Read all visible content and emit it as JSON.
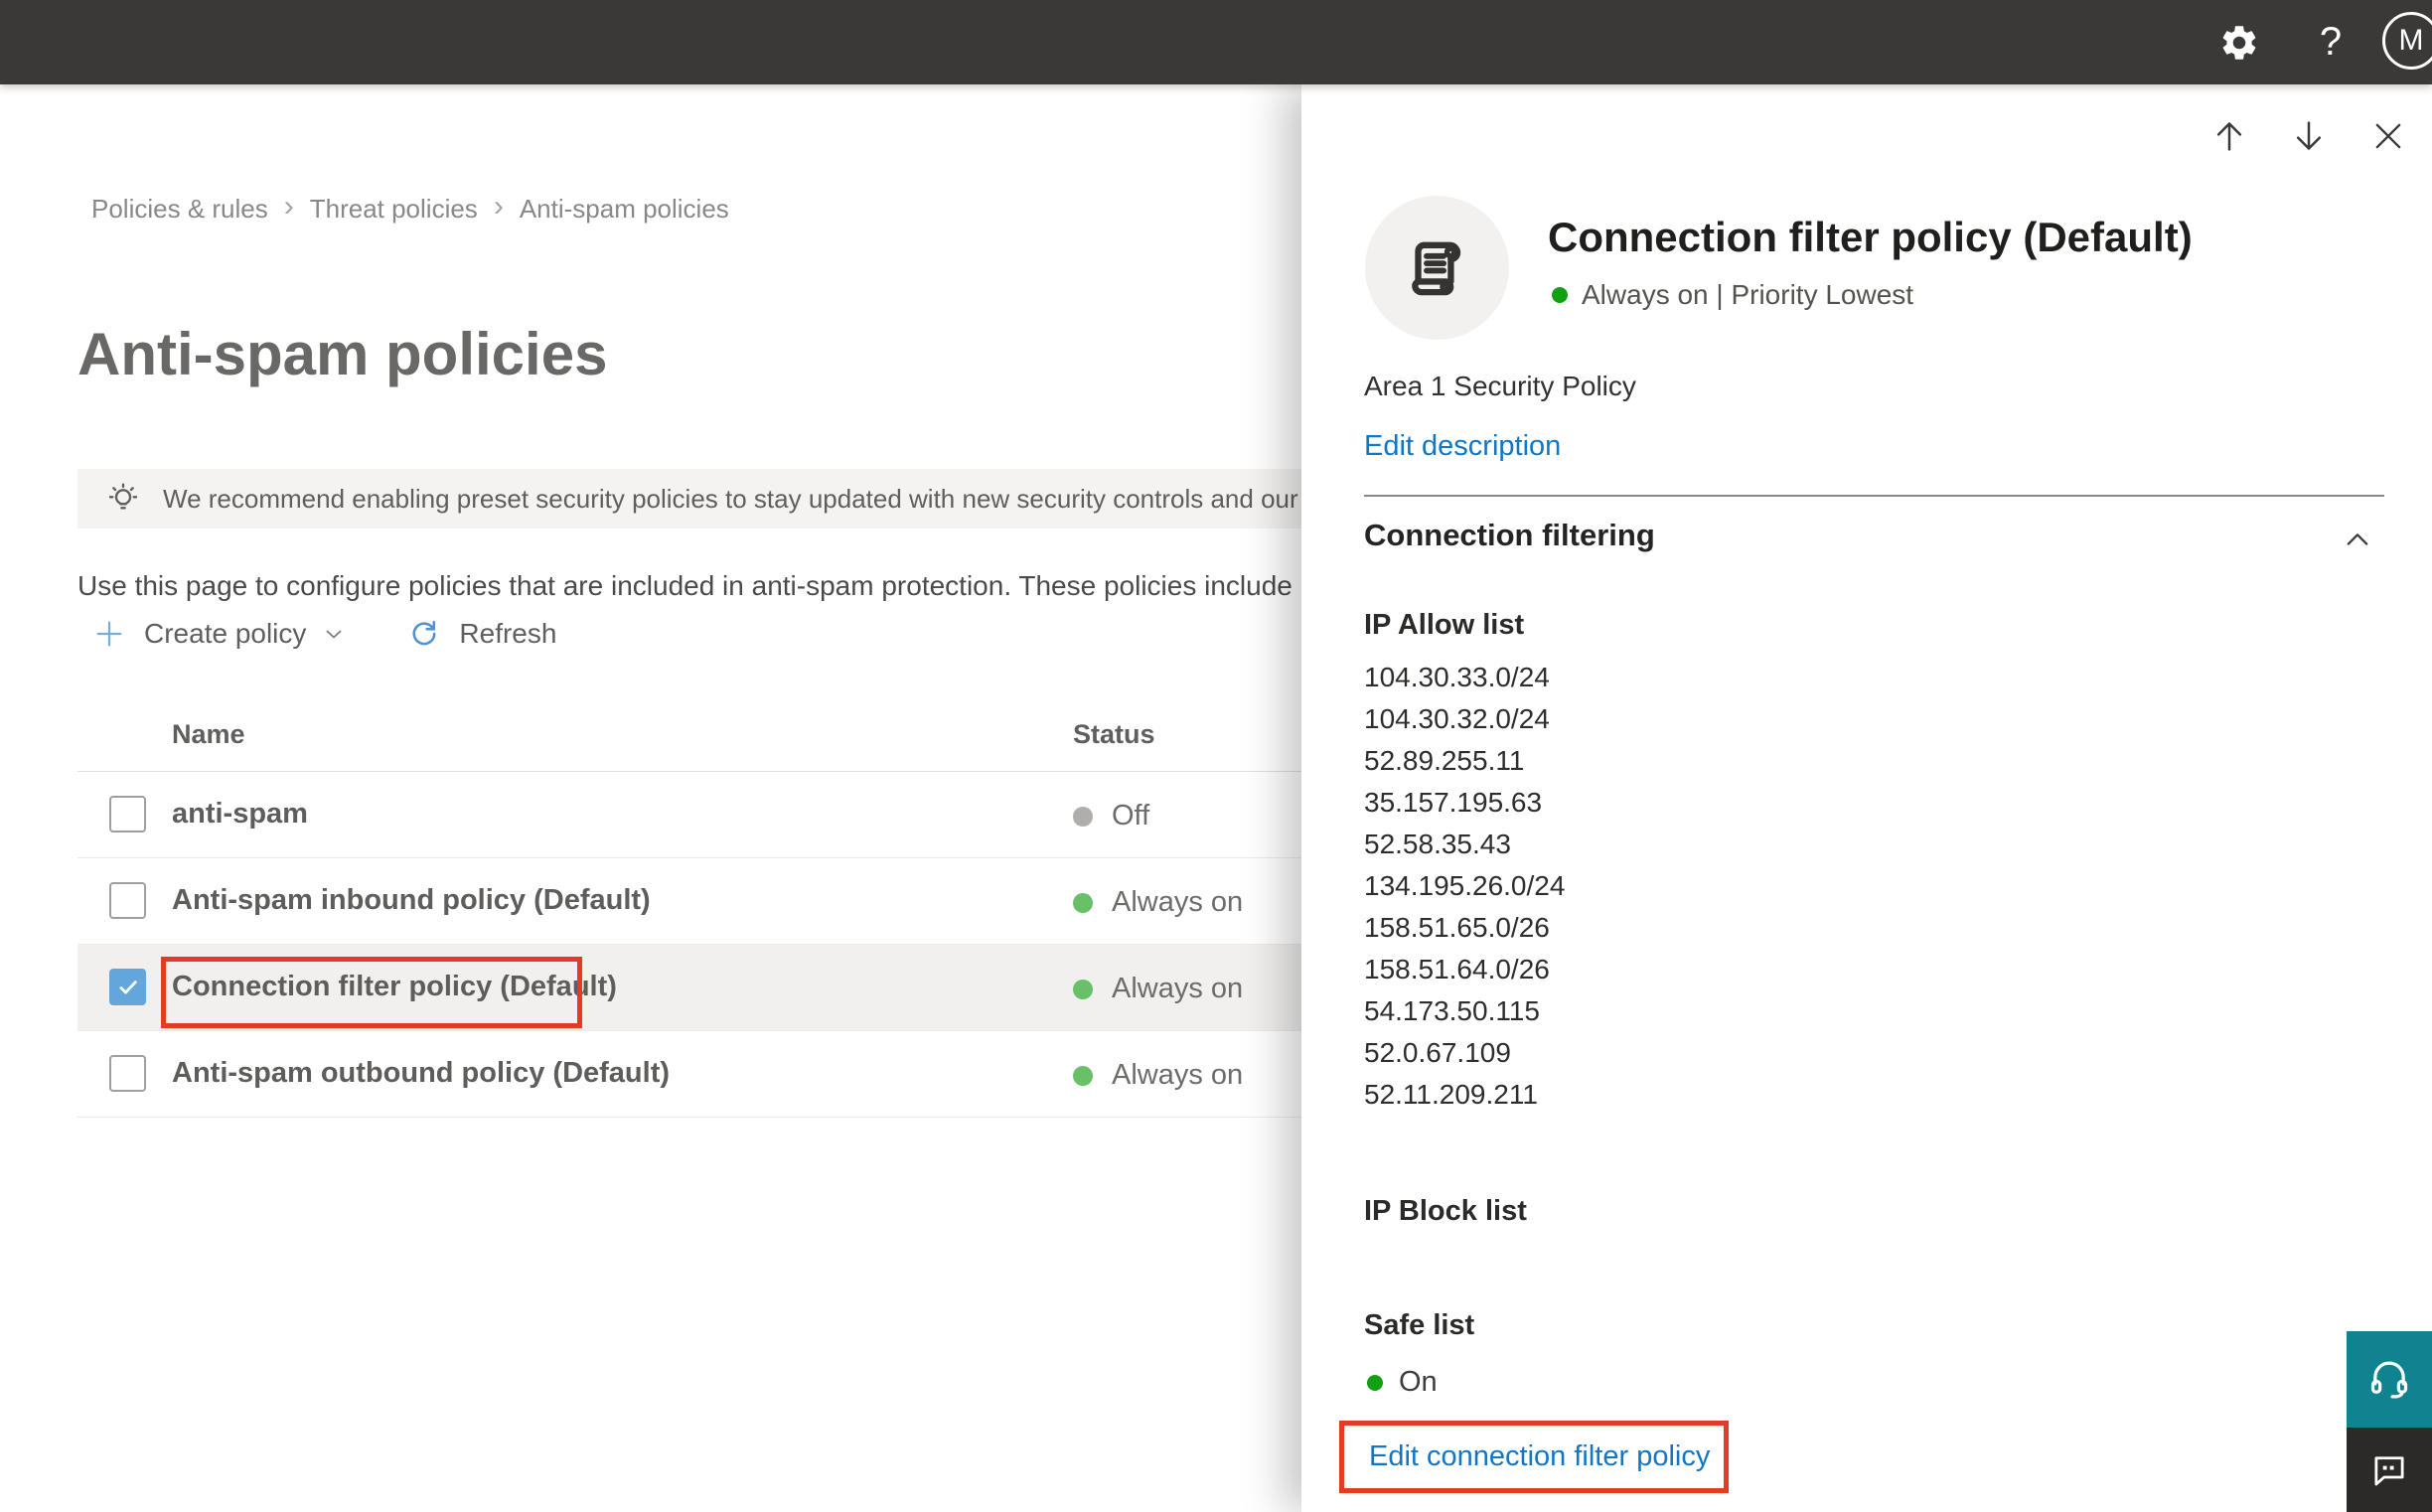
{
  "topbar": {
    "avatar_initial": "M",
    "help_label": "?"
  },
  "breadcrumb": {
    "items": [
      "Policies & rules",
      "Threat policies",
      "Anti-spam policies"
    ]
  },
  "page": {
    "title": "Anti-spam policies",
    "banner_text": "We recommend enabling preset security policies to stay updated with new security controls and our recomme",
    "description": "Use this page to configure policies that are included in anti-spam protection. These policies include",
    "toolbar": {
      "create_policy": "Create policy",
      "refresh": "Refresh"
    },
    "table": {
      "columns": [
        "Name",
        "Status"
      ],
      "rows": [
        {
          "name": "anti-spam",
          "status": "Off",
          "status_color": "gray",
          "checked": false,
          "selected": false
        },
        {
          "name": "Anti-spam inbound policy (Default)",
          "status": "Always on",
          "status_color": "green",
          "checked": false,
          "selected": false
        },
        {
          "name": "Connection filter policy (Default)",
          "status": "Always on",
          "status_color": "green",
          "checked": true,
          "selected": true,
          "annotated": true
        },
        {
          "name": "Anti-spam outbound policy (Default)",
          "status": "Always on",
          "status_color": "green",
          "checked": false,
          "selected": false
        }
      ]
    }
  },
  "panel": {
    "title": "Connection filter policy (Default)",
    "subtitle": "Always on | Priority Lowest",
    "description": "Area 1 Security Policy",
    "edit_description_link": "Edit description",
    "section_title": "Connection filtering",
    "ip_allow_title": "IP Allow list",
    "ip_allow": [
      "104.30.33.0/24",
      "104.30.32.0/24",
      "52.89.255.11",
      "35.157.195.63",
      "52.58.35.43",
      "134.195.26.0/24",
      "158.51.65.0/26",
      "158.51.64.0/26",
      "54.173.50.115",
      "52.0.67.109",
      "52.11.209.211"
    ],
    "ip_block_title": "IP Block list",
    "safe_list_title": "Safe list",
    "safe_list_status": "On",
    "edit_link": "Edit connection filter policy"
  },
  "colors": {
    "topbar_bg": "#3a3938",
    "accent_link_blue": "#1076c5",
    "status_green_panel": "#12a012",
    "status_green_table": "#6abf69",
    "status_gray_off": "#b0aeac",
    "annotation_red": "#e23c25",
    "checkbox_blue": "#63a6dc",
    "support_teal": "#0f8490",
    "feedback_dark": "#2b2a28",
    "banner_bg": "#f4f3f2",
    "selected_row_bg": "#f1f0ef"
  },
  "icons": {
    "topbar": [
      "gear-icon",
      "help-icon",
      "avatar"
    ],
    "panel": [
      "arrow-up-icon",
      "arrow-down-icon",
      "close-icon",
      "scroll-icon",
      "chevron-up-icon"
    ],
    "toolbar": [
      "plus-icon",
      "chevron-down-icon",
      "refresh-icon"
    ],
    "misc": [
      "lightbulb-icon",
      "headset-icon",
      "feedback-icon",
      "check-icon"
    ]
  }
}
